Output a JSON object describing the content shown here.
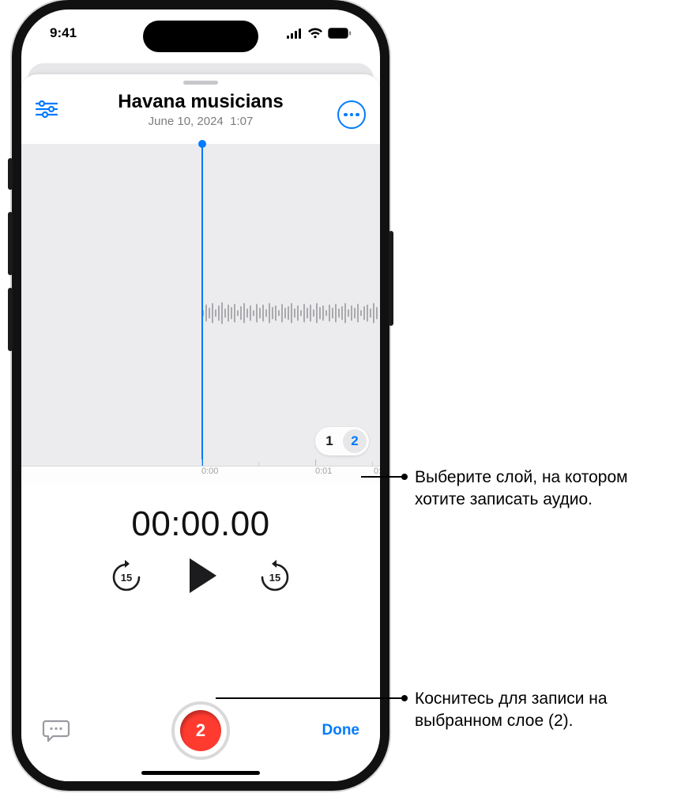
{
  "statusbar": {
    "time": "9:41"
  },
  "sheet": {
    "title": "Havana musicians",
    "date": "June 10, 2024",
    "duration": "1:07"
  },
  "ruler": {
    "t0": "0:00",
    "t1": "0:01",
    "t2": "0:"
  },
  "layers": {
    "one": "1",
    "two": "2"
  },
  "playback": {
    "timecode": "00:00.00",
    "skip": "15"
  },
  "record": {
    "layer_badge": "2"
  },
  "footer": {
    "done": "Done"
  },
  "callouts": {
    "layer_select": "Выберите слой, на котором хотите записать аудио.",
    "record": "Коснитесь для записи на выбранном слое (2)."
  }
}
